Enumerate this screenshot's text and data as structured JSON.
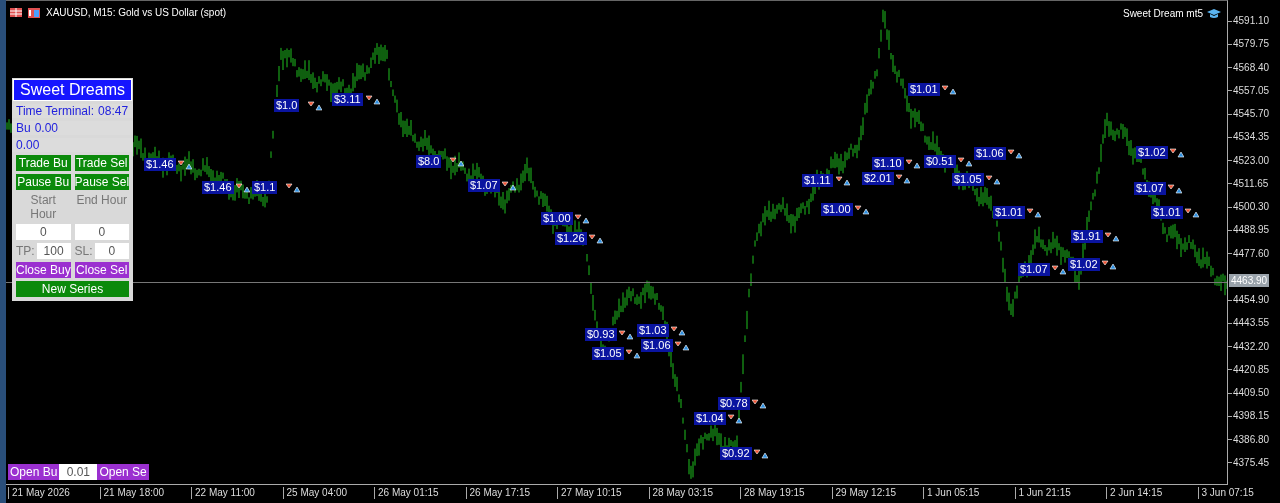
{
  "window": {
    "title": "XAUUSD, M15:  Gold vs US Dollar (spot)"
  },
  "indicator_label": "Sweet Dream mt5",
  "panel": {
    "title": "Sweet Dreams",
    "info": [
      {
        "label": "Time Terminal:",
        "value": "08:47"
      },
      {
        "label": "Bu",
        "value": "0.00"
      },
      {
        "value": "0.00"
      }
    ],
    "rows": [
      {
        "kind": "buttons",
        "items": [
          {
            "label": "Trade Bu",
            "color": "#0b8a0b"
          },
          {
            "label": "Trade Sel",
            "color": "#0b8a0b"
          }
        ]
      },
      {
        "kind": "buttons",
        "items": [
          {
            "label": "Pause Bu",
            "color": "#0b8a0b"
          },
          {
            "label": "Pause Sel",
            "color": "#0b8a0b"
          }
        ]
      },
      {
        "kind": "captions",
        "items": [
          {
            "label": "Start Hour"
          },
          {
            "label": "End Hour"
          }
        ]
      },
      {
        "kind": "inputs",
        "items": [
          {
            "value": "0"
          },
          {
            "value": "0"
          }
        ]
      },
      {
        "kind": "labeled_inputs",
        "items": [
          {
            "label": "TP:",
            "value": "100"
          },
          {
            "label": "SL:",
            "value": "0"
          }
        ]
      },
      {
        "kind": "buttons",
        "items": [
          {
            "label": "Close Buy",
            "color": "#9b30d0"
          },
          {
            "label": "Close Sel",
            "color": "#9b30d0"
          }
        ]
      },
      {
        "kind": "buttons",
        "items": [
          {
            "label": "New Series",
            "color": "#0b8a0b"
          }
        ]
      }
    ]
  },
  "order_bar": {
    "buy_label": "Open Bu",
    "lot": "0.01",
    "sell_label": "Open Se"
  },
  "trade_labels": [
    {
      "text": "$1.46"
    },
    {
      "text": "$1.46"
    },
    {
      "text": "$1.1"
    },
    {
      "text": "$3.11"
    },
    {
      "text": "$1.0"
    },
    {
      "text": "$8.0"
    },
    {
      "text": "$1.07"
    },
    {
      "text": "$1.00"
    },
    {
      "text": "$1.26"
    },
    {
      "text": "$0.93"
    },
    {
      "text": "$1.05"
    },
    {
      "text": "$1.03"
    },
    {
      "text": "$1.06"
    },
    {
      "text": "$1.04"
    },
    {
      "text": "$0.78"
    },
    {
      "text": "$0.92"
    },
    {
      "text": "$1.11"
    },
    {
      "text": "$1.00"
    },
    {
      "text": "$2.01"
    },
    {
      "text": "$1.10"
    },
    {
      "text": "$1.01"
    },
    {
      "text": "$0.51"
    },
    {
      "text": "$1.06"
    },
    {
      "text": "$1.05"
    },
    {
      "text": "$1.01"
    },
    {
      "text": "$1.07"
    },
    {
      "text": "$1.91"
    },
    {
      "text": "$1.02"
    },
    {
      "text": "$1.02"
    },
    {
      "text": "$1.07"
    },
    {
      "text": "$1.01"
    }
  ],
  "price_axis": {
    "ticks": [
      "4591.10",
      "4579.75",
      "4568.40",
      "4557.05",
      "4545.70",
      "4534.35",
      "4523.00",
      "4511.65",
      "4500.30",
      "4488.95",
      "4477.60",
      "4454.90",
      "4443.55",
      "4432.20",
      "4420.85",
      "4409.50",
      "4398.15",
      "4386.80",
      "4375.45"
    ],
    "current": "4463.90"
  },
  "time_axis": {
    "labels": [
      "21 May 2026",
      "21 May 18:00",
      "22 May 11:00",
      "25 May 04:00",
      "26 May 01:15",
      "26 May 17:15",
      "27 May 10:15",
      "28 May 03:15",
      "28 May 19:15",
      "29 May 12:15",
      "1 Jun 05:15",
      "1 Jun 21:15",
      "2 Jun 14:15",
      "3 Jun 07:15"
    ]
  }
}
